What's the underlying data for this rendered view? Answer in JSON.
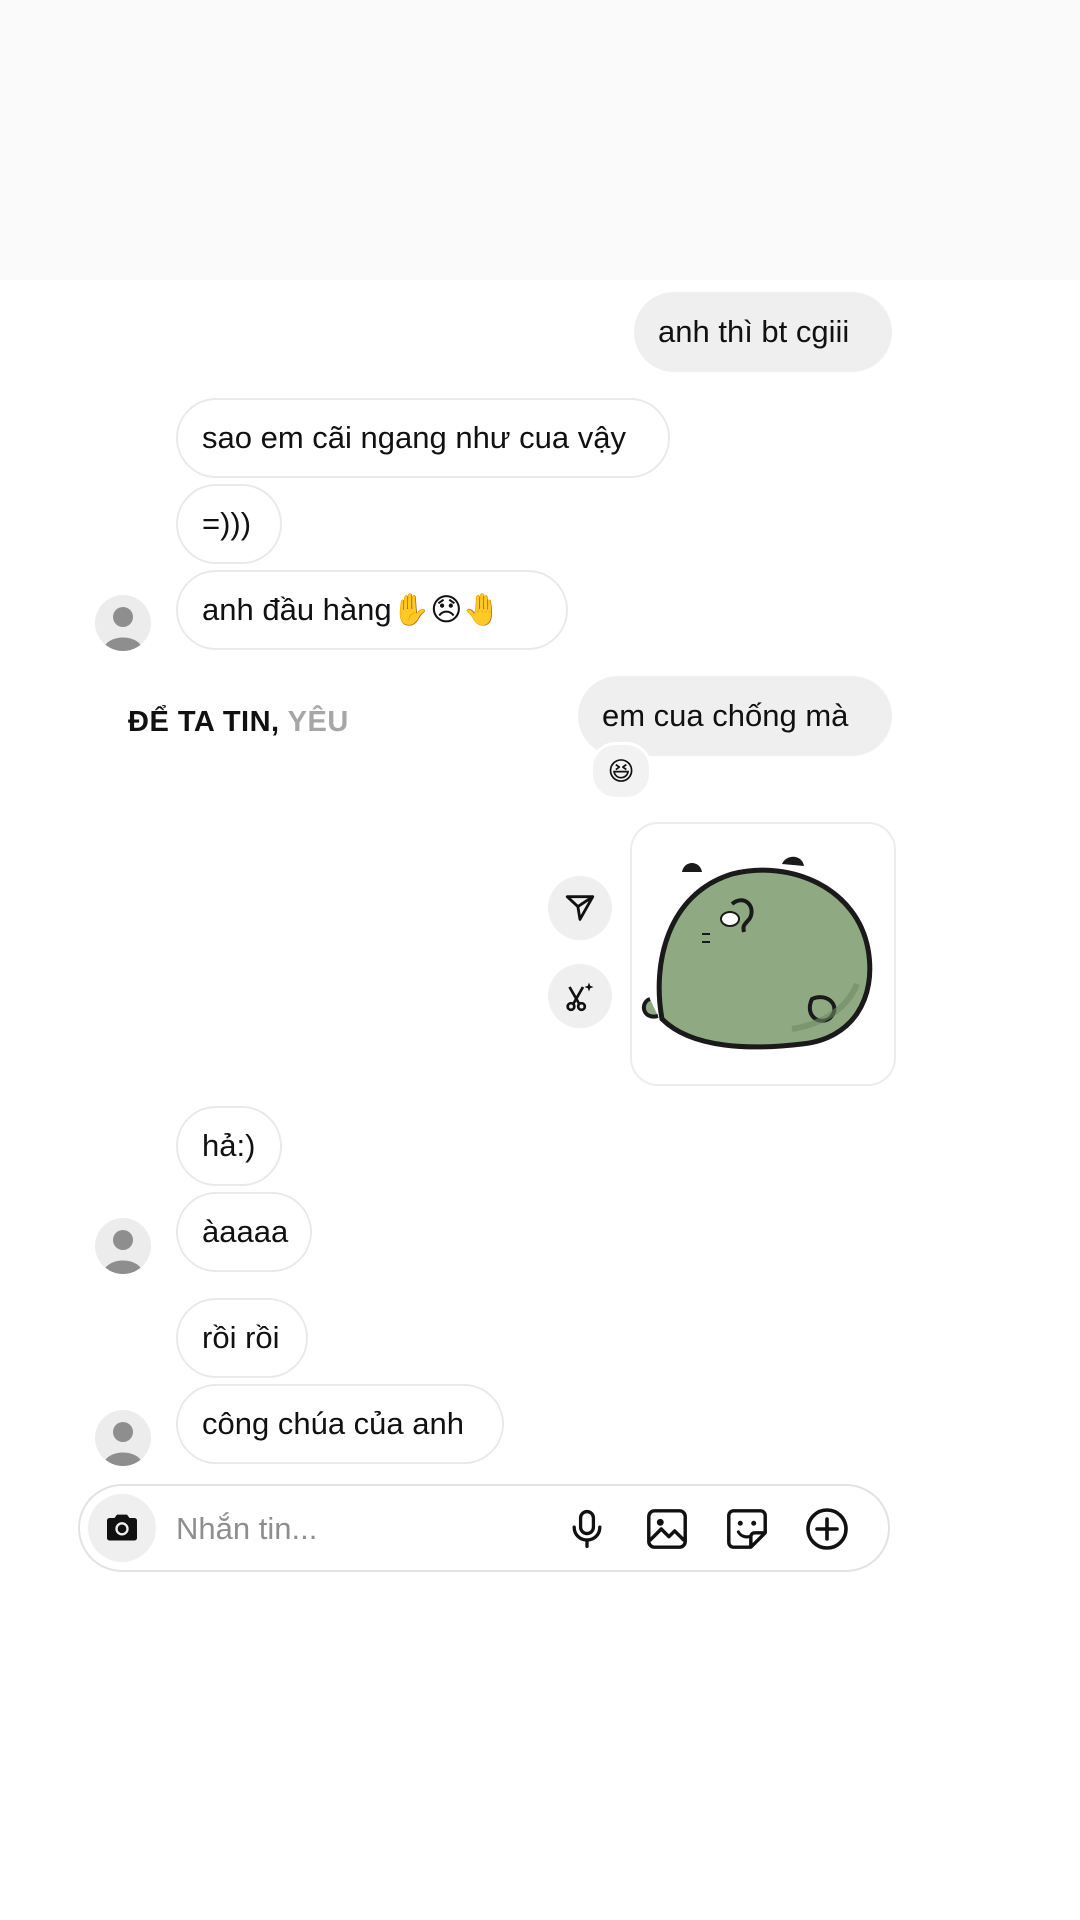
{
  "messages": [
    {
      "side": "out",
      "text": "anh thì bt cgiii"
    },
    {
      "side": "in",
      "text": "sao em cãi ngang như cua vậy"
    },
    {
      "side": "in",
      "text": "=)))"
    },
    {
      "side": "in",
      "text": "anh đầu hàng✋😞🤚"
    },
    {
      "side": "out",
      "text": "em cua chống mà"
    },
    {
      "side": "in",
      "text": "hả:)"
    },
    {
      "side": "in",
      "text": "àaaaa"
    },
    {
      "side": "in",
      "text": "rồi rồi"
    },
    {
      "side": "in",
      "text": "công chúa của anh"
    }
  ],
  "reaction": {
    "emoji": "😆"
  },
  "overlay": {
    "dark": "ĐỂ TA TIN, ",
    "light": "YÊU"
  },
  "composer": {
    "placeholder": "Nhắn tin..."
  },
  "icons": {
    "camera": "camera-icon",
    "mic": "microphone-icon",
    "gallery": "gallery-icon",
    "sticker": "sticker-icon",
    "plus": "plus-circle-icon",
    "forward": "forward-icon",
    "remix": "remix-icon"
  },
  "colors": {
    "outgoing_bubble": "#efefef",
    "incoming_border": "#e9e9e9",
    "sticker_green": "#8faa82",
    "placeholder": "#8e8e8e"
  }
}
